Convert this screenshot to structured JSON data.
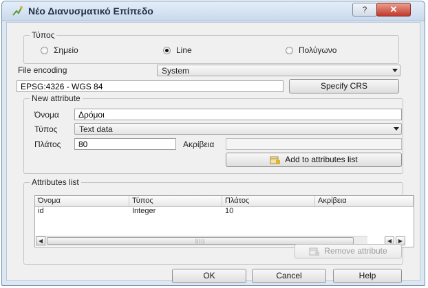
{
  "window": {
    "title": "Νέο Διανυσματικό Επίπεδο",
    "help_glyph": "?",
    "close_glyph": "✕"
  },
  "type_group": {
    "title": "Τύπος",
    "options": [
      {
        "label": "Σημείο",
        "selected": false
      },
      {
        "label": "Line",
        "selected": true
      },
      {
        "label": "Πολύγωνο",
        "selected": false
      }
    ]
  },
  "encoding": {
    "label": "File encoding",
    "value": "System"
  },
  "crs": {
    "value": "EPSG:4326 - WGS 84",
    "button": "Specify CRS"
  },
  "new_attribute": {
    "title": "New attribute",
    "name_label": "Όνομα",
    "name_value": "Δρόμοι",
    "type_label": "Τύπος",
    "type_value": "Text data",
    "width_label": "Πλάτος",
    "width_value": "80",
    "precision_label": "Ακρίβεια",
    "precision_value": "",
    "add_button": "Add to attributes list"
  },
  "attributes_list": {
    "title": "Attributes list",
    "columns": [
      "Όνομα",
      "Τύπος",
      "Πλάτος",
      "Ακρίβεια"
    ],
    "rows": [
      [
        "id",
        "Integer",
        "10",
        ""
      ]
    ],
    "remove_button": "Remove attribute",
    "scroll_left": "◀",
    "scroll_right": "▶",
    "grip": "|||||"
  },
  "footer": {
    "ok": "OK",
    "cancel": "Cancel",
    "help": "Help"
  },
  "colors": {
    "title_bg": "#c9d9ec",
    "close_bg": "#c0392b",
    "client_bg": "#f0f0f0",
    "icon_green": "#5c9a2e",
    "icon_yellow": "#e0b23a"
  }
}
